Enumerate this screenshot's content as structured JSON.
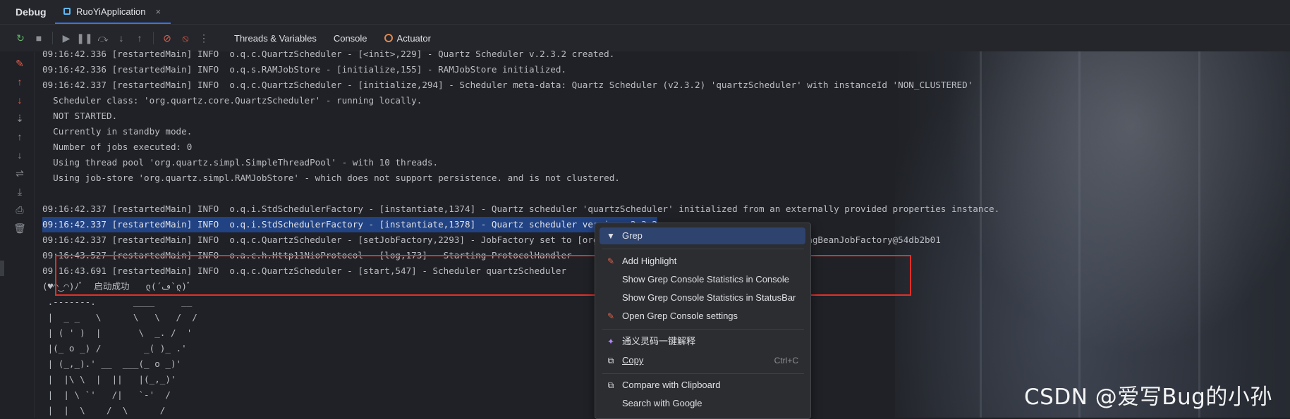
{
  "titlebar": {
    "debug_label": "Debug",
    "run_tab": "RuoYiApplication",
    "close_glyph": "×"
  },
  "toolbar": {
    "tabs": [
      "Threads & Variables",
      "Console",
      "Actuator"
    ]
  },
  "console": {
    "lines": [
      "09:16:42.336 [restartedMain] INFO  o.q.c.QuartzScheduler - [<init>,229] - Quartz Scheduler v.2.3.2 created.",
      "09:16:42.336 [restartedMain] INFO  o.q.s.RAMJobStore - [initialize,155] - RAMJobStore initialized.",
      "09:16:42.337 [restartedMain] INFO  o.q.c.QuartzScheduler - [initialize,294] - Scheduler meta-data: Quartz Scheduler (v2.3.2) 'quartzScheduler' with instanceId 'NON_CLUSTERED'",
      "  Scheduler class: 'org.quartz.core.QuartzScheduler' - running locally.",
      "  NOT STARTED.",
      "  Currently in standby mode.",
      "  Number of jobs executed: 0",
      "  Using thread pool 'org.quartz.simpl.SimpleThreadPool' - with 10 threads.",
      "  Using job-store 'org.quartz.simpl.RAMJobStore' - which does not support persistence. and is not clustered.",
      "",
      "09:16:42.337 [restartedMain] INFO  o.q.i.StdSchedulerFactory - [instantiate,1374] - Quartz scheduler 'quartzScheduler' initialized from an externally provided properties instance.",
      "09:16:42.337 [restartedMain] INFO  o.q.i.StdSchedulerFactory - [instantiate,1378] - Quartz scheduler version: 2.3.2",
      "09:16:42.337 [restartedMain] INFO  o.q.c.QuartzScheduler - [setJobFactory,2293] - JobFactory set to [org.springframework.scheduling.quartz.SpringBeanJobFactory@54db2b01",
      "09:16:43.527 [restartedMain] INFO  o.a.c.h.Http11NioProtocol - [log,173] - Starting ProtocolHandler",
      "09:16:43.691 [restartedMain] INFO  o.q.c.QuartzScheduler - [start,547] - Scheduler quartzScheduler",
      "(♥◠‿◠)ﾉﾞ  启动成功   ლ(´ڡ`ლ)ﾞ",
      " .-------.       ____     __",
      " |  _ _   \\      \\   \\   /  /",
      " | ( ' )  |       \\  _. /  '",
      " |(_ o _) /        _( )_ .'",
      " | (_,_).' __  ___(_ o _)'",
      " |  |\\ \\  |  ||   |(_,_)'",
      " |  | \\ `'   /|   `-'  /",
      " |  |  \\    /  \\      /"
    ],
    "selected_line_index": 11
  },
  "context_menu": {
    "grep": "Grep",
    "add_highlight": "Add Highlight",
    "stats_console": "Show Grep Console Statistics in Console",
    "stats_statusbar": "Show Grep Console Statistics in StatusBar",
    "open_settings": "Open Grep Console settings",
    "tongyi": "通义灵码一键解释",
    "copy": "Copy",
    "copy_shortcut": "Ctrl+C",
    "compare": "Compare with Clipboard",
    "search_google": "Search with Google"
  },
  "watermark": "CSDN @爱写Bug的小孙"
}
